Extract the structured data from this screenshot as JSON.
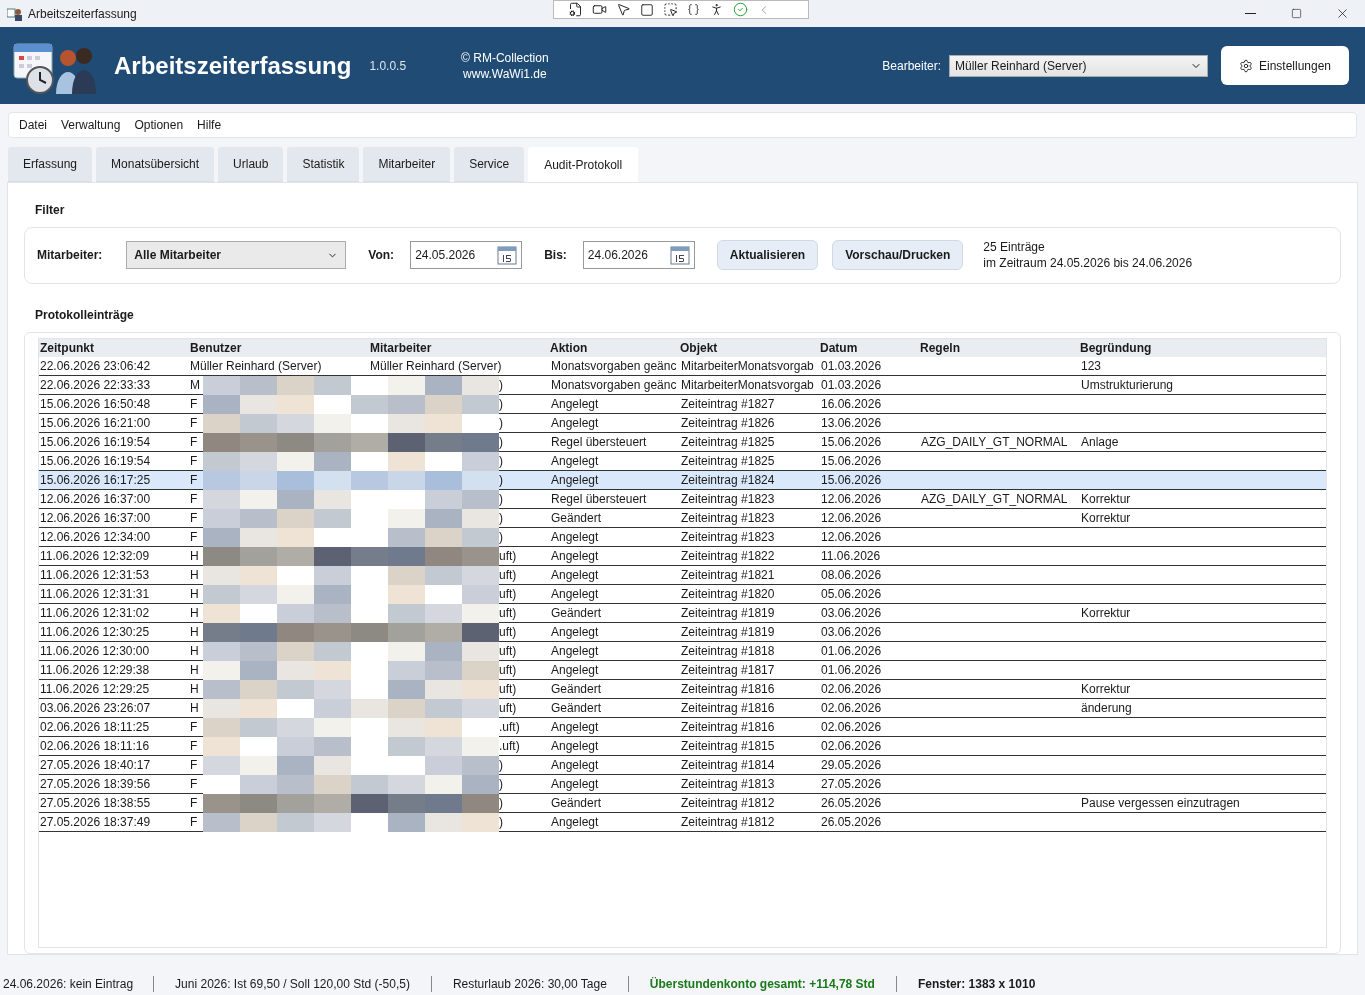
{
  "window": {
    "title": "Arbeitszeiterfassung"
  },
  "header": {
    "title": "Arbeitszeiterfassung",
    "version": "1.0.0.5",
    "copyright": "© RM-Collection",
    "website": "www.WaWi1.de",
    "editor_label": "Bearbeiter:",
    "editor_value": "Müller Reinhard (Server)",
    "settings_button": "Einstellungen"
  },
  "menu": [
    "Datei",
    "Verwaltung",
    "Optionen",
    "Hilfe"
  ],
  "tabs": [
    {
      "label": "Erfassung",
      "selected": false
    },
    {
      "label": "Monatsübersicht",
      "selected": false
    },
    {
      "label": "Urlaub",
      "selected": false
    },
    {
      "label": "Statistik",
      "selected": false
    },
    {
      "label": "Mitarbeiter",
      "selected": false
    },
    {
      "label": "Service",
      "selected": false
    },
    {
      "label": "Audit-Protokoll",
      "selected": true
    }
  ],
  "filter": {
    "heading": "Filter",
    "employee_label": "Mitarbeiter:",
    "employee_value": "Alle Mitarbeiter",
    "from_label": "Von:",
    "from_value": "24.05.2026",
    "to_label": "Bis:",
    "to_value": "24.06.2026",
    "refresh_button": "Aktualisieren",
    "print_button": "Vorschau/Drucken",
    "count": "25 Einträge",
    "range": "im Zeitraum 24.05.2026 bis 24.06.2026"
  },
  "log": {
    "heading": "Protokolleinträge",
    "columns": [
      "Zeitpunkt",
      "Benutzer",
      "Mitarbeiter",
      "Aktion",
      "Objekt",
      "Datum",
      "Regeln",
      "Begründung"
    ],
    "rows": [
      {
        "cells": [
          "22.06.2026 23:06:42",
          "Müller Reinhard (Server)",
          "Müller Reinhard (Server)",
          "Monatsvorgaben geänc",
          "MitarbeiterMonatsvorgab",
          "01.03.2026",
          "",
          "123"
        ],
        "selected": false
      },
      {
        "cells": [
          "22.06.2026 22:33:33",
          "M",
          ")",
          "Monatsvorgaben geänc",
          "MitarbeiterMonatsvorgab",
          "01.03.2026",
          "",
          "Umstrukturierung"
        ],
        "selected": false
      },
      {
        "cells": [
          "15.06.2026 16:50:48",
          "F",
          ")",
          "Angelegt",
          "Zeiteintrag #1827",
          "16.06.2026",
          "",
          ""
        ],
        "selected": false
      },
      {
        "cells": [
          "15.06.2026 16:21:00",
          "F",
          ")",
          "Angelegt",
          "Zeiteintrag #1826",
          "13.06.2026",
          "",
          ""
        ],
        "selected": false
      },
      {
        "cells": [
          "15.06.2026 16:19:54",
          "F",
          ")",
          "Regel übersteuert",
          "Zeiteintrag #1825",
          "15.06.2026",
          "AZG_DAILY_GT_NORMAL",
          "Anlage"
        ],
        "selected": false
      },
      {
        "cells": [
          "15.06.2026 16:19:54",
          "F",
          ")",
          "Angelegt",
          "Zeiteintrag #1825",
          "15.06.2026",
          "",
          ""
        ],
        "selected": false
      },
      {
        "cells": [
          "15.06.2026 16:17:25",
          "F",
          ")",
          "Angelegt",
          "Zeiteintrag #1824",
          "15.06.2026",
          "",
          ""
        ],
        "selected": true
      },
      {
        "cells": [
          "12.06.2026 16:37:00",
          "F",
          ")",
          "Regel übersteuert",
          "Zeiteintrag #1823",
          "12.06.2026",
          "AZG_DAILY_GT_NORMAL",
          "Korrektur"
        ],
        "selected": false
      },
      {
        "cells": [
          "12.06.2026 16:37:00",
          "F",
          ")",
          "Geändert",
          "Zeiteintrag #1823",
          "12.06.2026",
          "",
          "Korrektur"
        ],
        "selected": false
      },
      {
        "cells": [
          "12.06.2026 12:34:00",
          "F",
          ")",
          "Angelegt",
          "Zeiteintrag #1823",
          "12.06.2026",
          "",
          ""
        ],
        "selected": false
      },
      {
        "cells": [
          "11.06.2026 12:32:09",
          "H",
          "uft)",
          "Angelegt",
          "Zeiteintrag #1822",
          "11.06.2026",
          "",
          ""
        ],
        "selected": false
      },
      {
        "cells": [
          "11.06.2026 12:31:53",
          "H",
          "uft)",
          "Angelegt",
          "Zeiteintrag #1821",
          "08.06.2026",
          "",
          ""
        ],
        "selected": false
      },
      {
        "cells": [
          "11.06.2026 12:31:31",
          "H",
          "uft)",
          "Angelegt",
          "Zeiteintrag #1820",
          "05.06.2026",
          "",
          ""
        ],
        "selected": false
      },
      {
        "cells": [
          "11.06.2026 12:31:02",
          "H",
          "uft)",
          "Geändert",
          "Zeiteintrag #1819",
          "03.06.2026",
          "",
          "Korrektur"
        ],
        "selected": false
      },
      {
        "cells": [
          "11.06.2026 12:30:25",
          "H",
          "uft)",
          "Angelegt",
          "Zeiteintrag #1819",
          "03.06.2026",
          "",
          ""
        ],
        "selected": false
      },
      {
        "cells": [
          "11.06.2026 12:30:00",
          "H",
          "uft)",
          "Angelegt",
          "Zeiteintrag #1818",
          "01.06.2026",
          "",
          ""
        ],
        "selected": false
      },
      {
        "cells": [
          "11.06.2026 12:29:38",
          "H",
          "uft)",
          "Angelegt",
          "Zeiteintrag #1817",
          "01.06.2026",
          "",
          ""
        ],
        "selected": false
      },
      {
        "cells": [
          "11.06.2026 12:29:25",
          "H",
          "uft)",
          "Geändert",
          "Zeiteintrag #1816",
          "02.06.2026",
          "",
          "Korrektur"
        ],
        "selected": false
      },
      {
        "cells": [
          "03.06.2026 23:26:07",
          "H",
          "uft)",
          "Geändert",
          "Zeiteintrag #1816",
          "02.06.2026",
          "",
          "änderung"
        ],
        "selected": false
      },
      {
        "cells": [
          "02.06.2026 18:11:25",
          "F",
          ".uft)",
          "Angelegt",
          "Zeiteintrag #1816",
          "02.06.2026",
          "",
          ""
        ],
        "selected": false
      },
      {
        "cells": [
          "02.06.2026 18:11:16",
          "F",
          ".uft)",
          "Angelegt",
          "Zeiteintrag #1815",
          "02.06.2026",
          "",
          ""
        ],
        "selected": false
      },
      {
        "cells": [
          "27.05.2026 18:40:17",
          "F",
          ")",
          "Angelegt",
          "Zeiteintrag #1814",
          "29.05.2026",
          "",
          ""
        ],
        "selected": false
      },
      {
        "cells": [
          "27.05.2026 18:39:56",
          "F",
          ")",
          "Angelegt",
          "Zeiteintrag #1813",
          "27.05.2026",
          "",
          ""
        ],
        "selected": false
      },
      {
        "cells": [
          "27.05.2026 18:38:55",
          "F",
          ")",
          "Geändert",
          "Zeiteintrag #1812",
          "26.05.2026",
          "",
          "Pause vergessen einzutragen"
        ],
        "selected": false
      },
      {
        "cells": [
          "27.05.2026 18:37:49",
          "F",
          ")",
          "Angelegt",
          "Zeiteintrag #1812",
          "26.05.2026",
          "",
          ""
        ],
        "selected": false
      }
    ]
  },
  "status_bar": [
    {
      "text": "24.06.2026: kein Eintrag",
      "kind": "plain"
    },
    {
      "text": "Juni 2026: Ist 69,50 / Soll 120,00 Std (-50,5)",
      "kind": "plain"
    },
    {
      "text": "Resturlaub 2026: 30,00 Tage",
      "kind": "plain"
    },
    {
      "text": "Überstundenkonto gesamt: +114,78 Std",
      "kind": "positive"
    },
    {
      "text": "Fenster: 1383 x 1010",
      "kind": "bold"
    }
  ]
}
